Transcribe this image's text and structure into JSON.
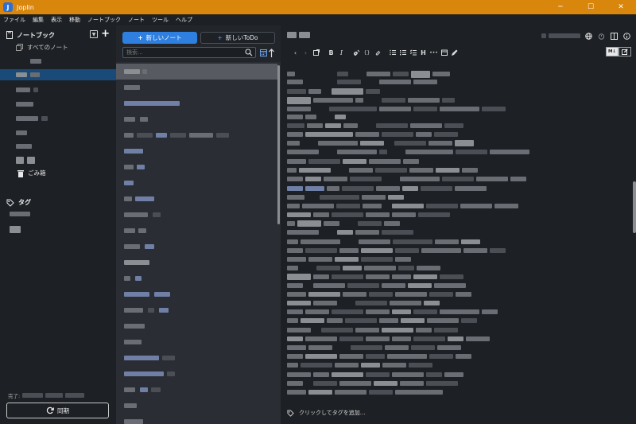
{
  "window": {
    "title": "Joplin",
    "app_icon_letter": "J",
    "controls": [
      "─",
      "☐",
      "✕"
    ]
  },
  "menu": [
    "ファイル",
    "編集",
    "表示",
    "移動",
    "ノートブック",
    "ノート",
    "ツール",
    "ヘルプ"
  ],
  "sidebar": {
    "notebooks_header": "ノートブック",
    "all_notes": "すべてのノート",
    "trash": "ごみ箱",
    "tags_header": "タグ",
    "sync_status_prefix": "完了:",
    "sync_button": "同期"
  },
  "notelist": {
    "new_note": "新しいノート",
    "new_todo": "新しいToDo",
    "search_placeholder": "検索..."
  },
  "editor": {
    "tag_prompt": "クリックしてタグを追加...",
    "toolbar": {
      "bold": "B",
      "italic": "I",
      "heading": "H",
      "more": "•••"
    },
    "toggle_active": "M↓"
  },
  "colors": {
    "titlebar": "#d9860c",
    "accent": "#2e7fe0",
    "selection": "#1a4b78"
  }
}
